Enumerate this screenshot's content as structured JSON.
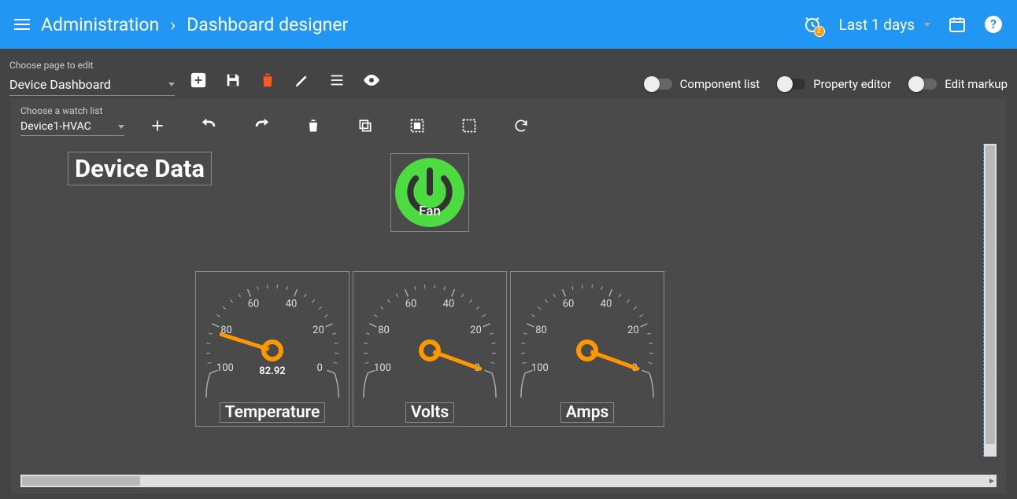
{
  "breadcrumb": {
    "root": "Administration",
    "page": "Dashboard designer"
  },
  "header": {
    "time_range": "Last 1 days",
    "alarm_badge": "2"
  },
  "editbar": {
    "page_select_label": "Choose page to edit",
    "page_select_value": "Device Dashboard",
    "toggles": {
      "component_list": "Component list",
      "property_editor": "Property editor",
      "edit_markup": "Edit markup"
    }
  },
  "canvas": {
    "watchlist_label": "Choose a watch list",
    "watchlist_value": "Device1-HVAC"
  },
  "title_text": "Device Data",
  "fan_label": "Fan",
  "gauges": [
    {
      "label": "Temperature",
      "value": 82.92,
      "value_text": "82.92",
      "ticks": {
        "t0": "0",
        "t20": "20",
        "t40": "40",
        "t60": "60",
        "t80": "80",
        "t100": "100"
      }
    },
    {
      "label": "Volts",
      "value": 0,
      "value_text": "",
      "ticks": {
        "t0": "0",
        "t20": "20",
        "t40": "40",
        "t60": "60",
        "t80": "80",
        "t100": "100"
      }
    },
    {
      "label": "Amps",
      "value": 0,
      "value_text": "",
      "ticks": {
        "t0": "0",
        "t20": "20",
        "t40": "40",
        "t60": "60",
        "t80": "80",
        "t100": "100"
      }
    }
  ],
  "chart_data": [
    {
      "type": "gauge",
      "title": "Temperature",
      "value": 82.92,
      "range": [
        0,
        100
      ],
      "ticks": [
        0,
        20,
        40,
        60,
        80,
        100
      ]
    },
    {
      "type": "gauge",
      "title": "Volts",
      "value": 0,
      "range": [
        0,
        100
      ],
      "ticks": [
        0,
        20,
        40,
        60,
        80,
        100
      ]
    },
    {
      "type": "gauge",
      "title": "Amps",
      "value": 0,
      "range": [
        0,
        100
      ],
      "ticks": [
        0,
        20,
        40,
        60,
        80,
        100
      ]
    }
  ]
}
